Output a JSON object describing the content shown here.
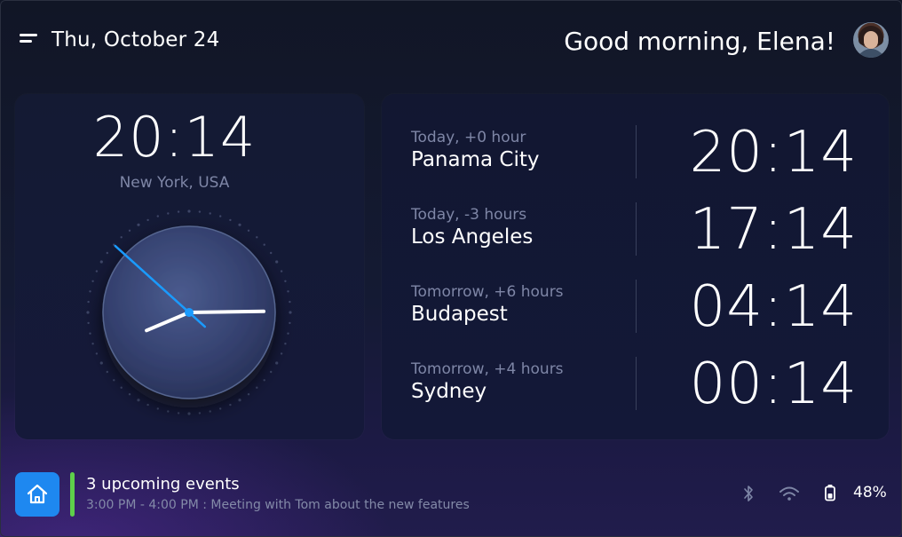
{
  "header": {
    "date": "Thu, October 24",
    "greeting": "Good morning, Elena!"
  },
  "local_clock": {
    "time": "20:14",
    "location": "New York, USA",
    "analog": {
      "hour": 8,
      "minute": 14,
      "second": 52
    }
  },
  "world_clocks": [
    {
      "offset": "Today, +0 hour",
      "city": "Panama City",
      "time": "20:14"
    },
    {
      "offset": "Today, -3 hours",
      "city": "Los Angeles",
      "time": "17:14"
    },
    {
      "offset": "Tomorrow, +6 hours",
      "city": "Budapest",
      "time": "04:14"
    },
    {
      "offset": "Tomorrow, +4 hours",
      "city": "Sydney",
      "time": "00:14"
    }
  ],
  "footer": {
    "events_title": "3 upcoming events",
    "events_detail": "3:00 PM - 4:00 PM : Meeting with Tom about the new features",
    "battery": "48%"
  },
  "icons": {
    "menu": "menu-icon",
    "home": "home-icon",
    "bluetooth": "bluetooth-icon",
    "wifi": "wifi-icon",
    "battery": "battery-icon"
  },
  "colors": {
    "accent_blue": "#1e88f0",
    "second_hand": "#1a9bff",
    "event_bar": "#5ed04a",
    "muted_text": "#7e86a6"
  }
}
